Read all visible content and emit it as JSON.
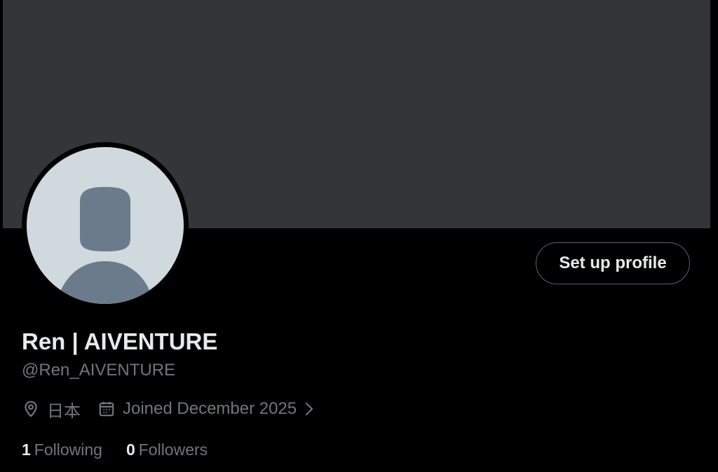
{
  "profile": {
    "display_name": "Ren | AIVENTURE",
    "handle": "@Ren_AIVENTURE",
    "location": "日本",
    "joined": "Joined December 2025",
    "setup_button_label": "Set up profile",
    "following_count": "1",
    "following_label": "Following",
    "followers_count": "0",
    "followers_label": "Followers"
  },
  "icons": {
    "location": "location-pin-icon",
    "joined": "calendar-icon",
    "joined_more": "chevron-right-icon",
    "avatar": "default-avatar-silhouette"
  },
  "colors": {
    "page_background": "#000000",
    "banner": "#333639",
    "avatar_background": "#cfd9de",
    "avatar_silhouette": "#6b7b8c",
    "primary_text": "#e7e9ea",
    "secondary_text": "#71767b",
    "button_border": "#536471"
  }
}
